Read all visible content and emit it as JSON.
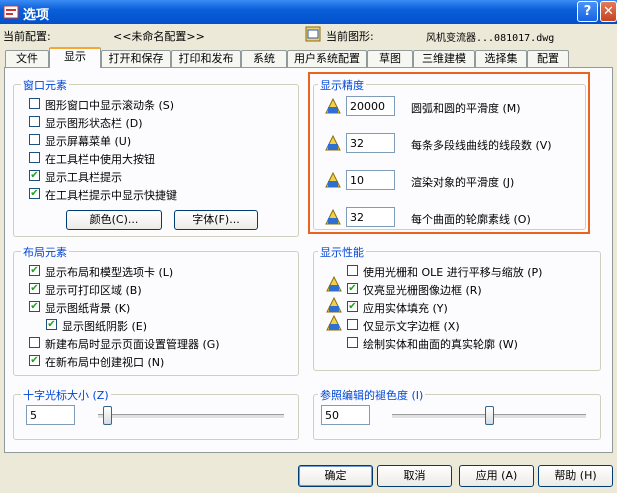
{
  "window": {
    "title": "选项",
    "help_glyph": "?",
    "close_glyph": "✕"
  },
  "header": {
    "current_profile_label": "当前配置:",
    "current_profile_value": "<<未命名配置>>",
    "current_drawing_label": "当前图形:",
    "current_drawing_value": "风机变流器...081017.dwg"
  },
  "tabs": [
    "文件",
    "显示",
    "打开和保存",
    "打印和发布",
    "系统",
    "用户系统配置",
    "草图",
    "三维建模",
    "选择集",
    "配置"
  ],
  "window_elements": {
    "title": "窗口元素",
    "checkboxes": [
      {
        "label": "图形窗口中显示滚动条 (S)",
        "checked": false
      },
      {
        "label": "显示图形状态栏 (D)",
        "checked": false
      },
      {
        "label": "显示屏幕菜单 (U)",
        "checked": false
      },
      {
        "label": "在工具栏中使用大按钮",
        "checked": false
      },
      {
        "label": "显示工具栏提示",
        "checked": true
      },
      {
        "label": "在工具栏提示中显示快捷键",
        "checked": true
      }
    ],
    "colors_button": "颜色(C)...",
    "fonts_button": "字体(F)..."
  },
  "display_resolution": {
    "title": "显示精度",
    "rows": [
      {
        "value": "20000",
        "label": "圆弧和圆的平滑度 (M)"
      },
      {
        "value": "32",
        "label": "每条多段线曲线的线段数 (V)"
      },
      {
        "value": "10",
        "label": "渲染对象的平滑度 (J)"
      },
      {
        "value": "32",
        "label": "每个曲面的轮廓素线 (O)"
      }
    ]
  },
  "layout_elements": {
    "title": "布局元素",
    "checkboxes": [
      {
        "label": "显示布局和模型选项卡 (L)",
        "checked": true
      },
      {
        "label": "显示可打印区域 (B)",
        "checked": true
      },
      {
        "label": "显示图纸背景 (K)",
        "checked": true
      },
      {
        "label": "显示图纸阴影 (E)",
        "checked": true
      },
      {
        "label": "新建布局时显示页面设置管理器 (G)",
        "checked": false
      },
      {
        "label": "在新布局中创建视口 (N)",
        "checked": true
      }
    ]
  },
  "display_performance": {
    "title": "显示性能",
    "checkboxes": [
      {
        "label": "使用光栅和 OLE 进行平移与缩放 (P)",
        "checked": false
      },
      {
        "label": "仅亮显光栅图像边框 (R)",
        "checked": true
      },
      {
        "label": "应用实体填充 (Y)",
        "checked": true
      },
      {
        "label": "仅显示文字边框 (X)",
        "checked": false
      },
      {
        "label": "绘制实体和曲面的真实轮廓 (W)",
        "checked": false
      }
    ]
  },
  "crosshair": {
    "title": "十字光标大小 (Z)",
    "value": "5",
    "level_fraction": 0.05
  },
  "xref_fade": {
    "title": "参照编辑的褪色度 (I)",
    "value": "50",
    "level_fraction": 0.5
  },
  "footer": {
    "ok": "确定",
    "cancel": "取消",
    "apply": "应用 (A)",
    "help": "帮助 (H)"
  },
  "check_glyph": "✔",
  "accent_color": "#e8641f"
}
